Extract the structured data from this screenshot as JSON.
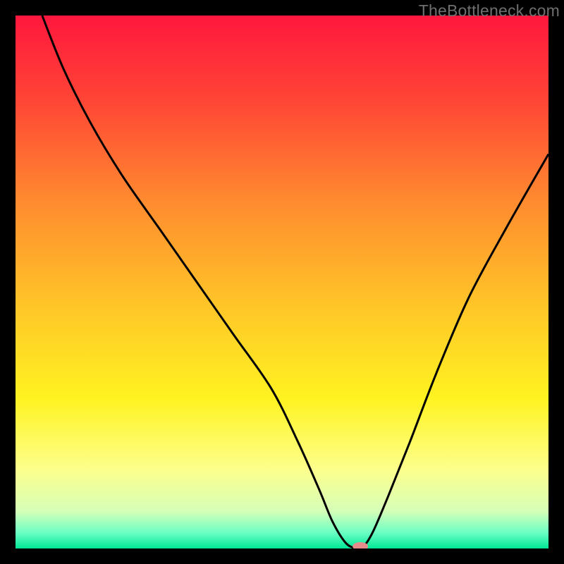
{
  "watermark": "TheBottleneck.com",
  "chart_data": {
    "type": "line",
    "title": "",
    "xlabel": "",
    "ylabel": "",
    "xlim": [
      0,
      100
    ],
    "ylim": [
      0,
      100
    ],
    "background_gradient": {
      "stops": [
        {
          "pct": 0,
          "color": "#ff173d"
        },
        {
          "pct": 15,
          "color": "#ff4236"
        },
        {
          "pct": 35,
          "color": "#ff8b2f"
        },
        {
          "pct": 55,
          "color": "#ffc728"
        },
        {
          "pct": 72,
          "color": "#fff321"
        },
        {
          "pct": 85,
          "color": "#fdff8b"
        },
        {
          "pct": 93,
          "color": "#d6ffb8"
        },
        {
          "pct": 97,
          "color": "#6dffc4"
        },
        {
          "pct": 100,
          "color": "#00e796"
        }
      ]
    },
    "series": [
      {
        "name": "curve",
        "x": [
          5,
          9,
          14,
          20,
          27,
          34,
          41,
          48,
          53,
          57,
          59.5,
          62,
          64,
          65,
          67,
          70,
          74,
          79,
          85,
          92,
          100
        ],
        "y": [
          100,
          90,
          80,
          70,
          60,
          50,
          40,
          30,
          20,
          11,
          5,
          1,
          0,
          0,
          3,
          10,
          20,
          33,
          47,
          60,
          74
        ]
      }
    ],
    "marker": {
      "x": 64.7,
      "y": 0,
      "color": "#e58c8d",
      "rx": 11,
      "ry": 6
    }
  }
}
